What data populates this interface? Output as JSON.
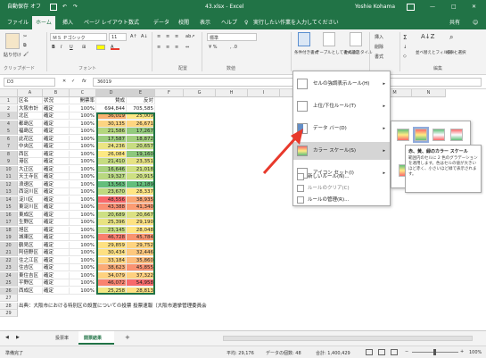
{
  "titlebar": {
    "autosave": "自動保存",
    "autosave_state": "オフ",
    "title": "43.xlsx - Excel",
    "user": "Yoshie Kohama",
    "restore_icon": "ribbon-display-icon",
    "window_buttons": [
      "—",
      "□",
      "✕"
    ]
  },
  "tabs": [
    "ファイル",
    "ホーム",
    "挿入",
    "ページ レイアウト",
    "数式",
    "データ",
    "校閲",
    "表示",
    "ヘルプ"
  ],
  "tell_me": "実行したい作業を入力してください",
  "share_label": "共有",
  "ribbon": {
    "clipboard": {
      "paste": "貼り付け",
      "group": "クリップボード"
    },
    "font": {
      "name": "ＭＳ Ｐゴシック",
      "size": "11",
      "bold": "B",
      "italic": "I",
      "underline": "U",
      "group": "フォント"
    },
    "alignment": {
      "group": "配置"
    },
    "number": {
      "format": "標準",
      "group": "数値"
    },
    "styles": {
      "conditional": "条件付き書式",
      "table": "テーブルとして書式設定",
      "cell": "セルのスタイル"
    },
    "cells": {
      "insert": "挿入",
      "delete": "削除",
      "format": "書式"
    },
    "editing": {
      "sort": "並べ替えとフィルター",
      "find": "検索と選択",
      "group": "編集"
    }
  },
  "formula_bar": {
    "name_box": "D3",
    "fx": "fx",
    "value": "36019"
  },
  "columns": [
    "A",
    "B",
    "C",
    "D",
    "E",
    "F",
    "G",
    "H",
    "I",
    "J",
    "K",
    "L",
    "M",
    "N"
  ],
  "header_row": [
    "区名",
    "状況",
    "開票率",
    "賛成",
    "反対"
  ],
  "rows": [
    {
      "ward": "大阪市計",
      "status": "確定",
      "rate": "100%",
      "yes": "694,844",
      "no": "705,585"
    },
    {
      "ward": "北区",
      "status": "確定",
      "rate": "100%",
      "yes": "36,019",
      "no": "25,009"
    },
    {
      "ward": "都島区",
      "status": "確定",
      "rate": "100%",
      "yes": "30,135",
      "no": "26,671"
    },
    {
      "ward": "福島区",
      "status": "確定",
      "rate": "100%",
      "yes": "21,586",
      "no": "17,267"
    },
    {
      "ward": "此花区",
      "status": "確定",
      "rate": "100%",
      "yes": "17,587",
      "no": "18,872"
    },
    {
      "ward": "中央区",
      "status": "確定",
      "rate": "100%",
      "yes": "24,236",
      "no": "20,657"
    },
    {
      "ward": "西区",
      "status": "確定",
      "rate": "100%",
      "yes": "26,084",
      "no": "19,160"
    },
    {
      "ward": "港区",
      "status": "確定",
      "rate": "100%",
      "yes": "21,410",
      "no": "23,351"
    },
    {
      "ward": "大正区",
      "status": "確定",
      "rate": "100%",
      "yes": "16,646",
      "no": "21,018"
    },
    {
      "ward": "天王寺区",
      "status": "確定",
      "rate": "100%",
      "yes": "19,327",
      "no": "20,915"
    },
    {
      "ward": "浪速区",
      "status": "確定",
      "rate": "100%",
      "yes": "13,563",
      "no": "12,189"
    },
    {
      "ward": "西淀川区",
      "status": "確定",
      "rate": "100%",
      "yes": "23,670",
      "no": "28,337"
    },
    {
      "ward": "淀川区",
      "status": "確定",
      "rate": "100%",
      "yes": "48,556",
      "no": "38,935"
    },
    {
      "ward": "東淀川区",
      "status": "確定",
      "rate": "100%",
      "yes": "43,388",
      "no": "41,340"
    },
    {
      "ward": "東成区",
      "status": "確定",
      "rate": "100%",
      "yes": "20,689",
      "no": "20,667"
    },
    {
      "ward": "生野区",
      "status": "確定",
      "rate": "100%",
      "yes": "25,396",
      "no": "29,190"
    },
    {
      "ward": "旭区",
      "status": "確定",
      "rate": "100%",
      "yes": "23,145",
      "no": "28,048"
    },
    {
      "ward": "城東区",
      "status": "確定",
      "rate": "100%",
      "yes": "46,728",
      "no": "45,784"
    },
    {
      "ward": "鶴見区",
      "status": "確定",
      "rate": "100%",
      "yes": "29,859",
      "no": "29,752"
    },
    {
      "ward": "阿倍野区",
      "status": "確定",
      "rate": "100%",
      "yes": "30,434",
      "no": "32,446"
    },
    {
      "ward": "住之江区",
      "status": "確定",
      "rate": "100%",
      "yes": "33,184",
      "no": "35,860"
    },
    {
      "ward": "住吉区",
      "status": "確定",
      "rate": "100%",
      "yes": "38,623",
      "no": "45,855"
    },
    {
      "ward": "東住吉区",
      "status": "確定",
      "rate": "100%",
      "yes": "34,079",
      "no": "37,322"
    },
    {
      "ward": "平野区",
      "status": "確定",
      "rate": "100%",
      "yes": "46,072",
      "no": "54,958"
    },
    {
      "ward": "西成区",
      "status": "確定",
      "rate": "100%",
      "yes": "25,258",
      "no": "28,813"
    }
  ],
  "yes_colors": [
    "#ffffff",
    "#f8b06e",
    "#fcd481",
    "#b3d67e",
    "#9dcd7e",
    "#ebe483",
    "#fde983",
    "#c5dc81",
    "#a8d17e",
    "#b8d880",
    "#63be7b",
    "#bfda80",
    "#f8696b",
    "#fa8f72",
    "#cde083",
    "#e8e382",
    "#c6dc81",
    "#f97e6f",
    "#fee182",
    "#fee082",
    "#fed580",
    "#fbab77",
    "#fed280",
    "#f98370",
    "#f2e783"
  ],
  "no_colors": [
    "#ffffff",
    "#fde783",
    "#fed580",
    "#92ca7d",
    "#a3cf7e",
    "#c7dc81",
    "#8dc87c",
    "#e6e283",
    "#cfe082",
    "#cde082",
    "#63be7b",
    "#ffe583",
    "#f9a574",
    "#fb9c73",
    "#dbe182",
    "#fee282",
    "#ffe683",
    "#f99370",
    "#fed480",
    "#fec87e",
    "#fdbc7c",
    "#fa9272",
    "#fed080",
    "#f8696b",
    "#ffe082"
  ],
  "row_numbers": [
    "1",
    "2",
    "3",
    "4",
    "5",
    "6",
    "7",
    "8",
    "9",
    "10",
    "11",
    "12",
    "13",
    "14",
    "15",
    "16",
    "17",
    "18",
    "19",
    "20",
    "21",
    "22",
    "23",
    "24",
    "25",
    "26",
    "27",
    "28",
    "29"
  ],
  "footnote": "出典：大阪市における特別区の設置についての投票 投票速報（大阪市選挙管理委員会",
  "menu": {
    "items": [
      {
        "label": "セルの強調表示ルール(H)",
        "icon": "highlight-rules-icon"
      },
      {
        "label": "上位/下位ルール(T)",
        "icon": "top-bottom-icon"
      },
      {
        "label": "データ バー(D)",
        "icon": "data-bar-icon"
      },
      {
        "label": "カラー スケール(S)",
        "icon": "color-scale-icon"
      },
      {
        "label": "アイコン セット(I)",
        "icon": "icon-set-icon"
      }
    ],
    "small_items": [
      "新しいルール(N)...",
      "ルールのクリア(C)",
      "ルールの管理(R)..."
    ]
  },
  "submenu": {
    "scales": [
      {
        "name": "green-yellow-red",
        "colors": [
          "#63be7b",
          "#ffeb84",
          "#f8696b"
        ]
      },
      {
        "name": "red-yellow-green",
        "colors": [
          "#f8696b",
          "#ffeb84",
          "#63be7b"
        ]
      },
      {
        "name": "green-white-red",
        "colors": [
          "#63be7b",
          "#fcfcff",
          "#f8696b"
        ]
      },
      {
        "name": "red-white-green",
        "colors": [
          "#f8696b",
          "#fcfcff",
          "#63be7b"
        ]
      }
    ]
  },
  "tooltip": {
    "title": "赤、黄、緑のカラー スケール",
    "body": "範囲内のセルに 2 色のグラデーションを適用します。色はセルの値が大きいほど赤く、小さいほど緑で表示されます。"
  },
  "sheets": [
    "投票率",
    "開票結果"
  ],
  "add_sheet": "+",
  "status": {
    "ready": "準備完了",
    "average": "平均: 29,176",
    "count": "データの個数: 48",
    "sum": "合計: 1,400,429",
    "zoom": "100%"
  },
  "accent": "#217346",
  "arrow_color": "#e8392c"
}
